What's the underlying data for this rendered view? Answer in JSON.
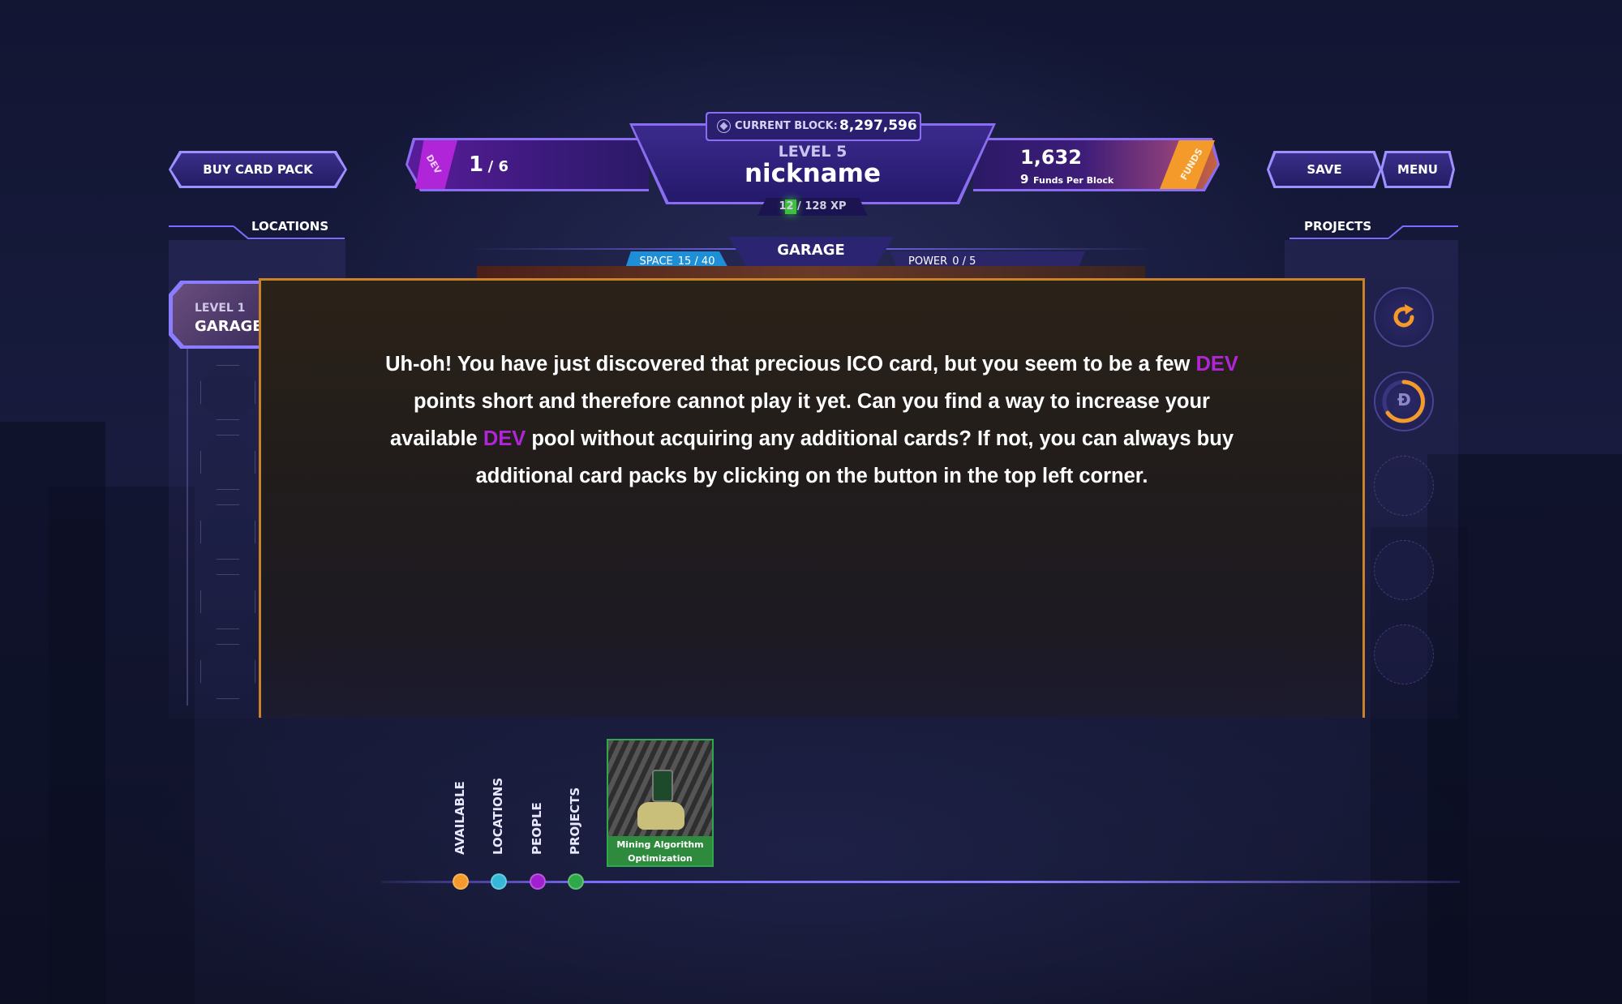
{
  "colors": {
    "dev": "#b125d9",
    "funds": "#f39a2a",
    "accent": "#7b6cff",
    "panel_border": "#c9822a",
    "xp_fill": "#3fbf3f",
    "space_badge": "#1e8fd6"
  },
  "top": {
    "buy_card_pack": "BUY CARD PACK",
    "save": "SAVE",
    "menu": "MENU",
    "dev_tag": "DEV",
    "dev_current": "1",
    "dev_max": "/ 6",
    "current_block_label": "CURRENT BLOCK:",
    "current_block_value": "8,297,596",
    "level": "LEVEL 5",
    "nickname": "nickname",
    "xp": "12 / 128 XP",
    "xp_progress": 0.094,
    "funds_value": "1,632",
    "funds_per_block_value": "9",
    "funds_per_block_label": "Funds Per Block",
    "funds_tag": "FUNDS"
  },
  "location_bar": {
    "space_label": "SPACE",
    "space_value": "15 / 40",
    "title": "GARAGE",
    "power_label": "POWER",
    "power_value": "0 / 5"
  },
  "left_panel": {
    "title": "LOCATIONS",
    "selected_level": "LEVEL 1",
    "selected_name": "GARAGE"
  },
  "right_panel": {
    "title": "PROJECTS"
  },
  "dialog": {
    "parts": [
      {
        "text": "Uh-oh! You have just discovered that precious ICO card, but you seem to be a few ",
        "dev": false
      },
      {
        "text": "DEV",
        "dev": true
      },
      {
        "text": " points short and therefore cannot play it yet. Can you find a way to increase your available ",
        "dev": false
      },
      {
        "text": "DEV",
        "dev": true
      },
      {
        "text": " pool without acquiring any additional cards? If not, you can always buy additional card packs by clicking on the button in the top left corner.",
        "dev": false
      }
    ]
  },
  "bottom": {
    "tabs": [
      {
        "label": "AVAILABLE",
        "color": "#f39a2a"
      },
      {
        "label": "LOCATIONS",
        "color": "#35b8d8"
      },
      {
        "label": "PEOPLE",
        "color": "#a020d0"
      },
      {
        "label": "PROJECTS",
        "color": "#2fa84a"
      }
    ],
    "card_title": "Mining Algorithm Optimization"
  }
}
